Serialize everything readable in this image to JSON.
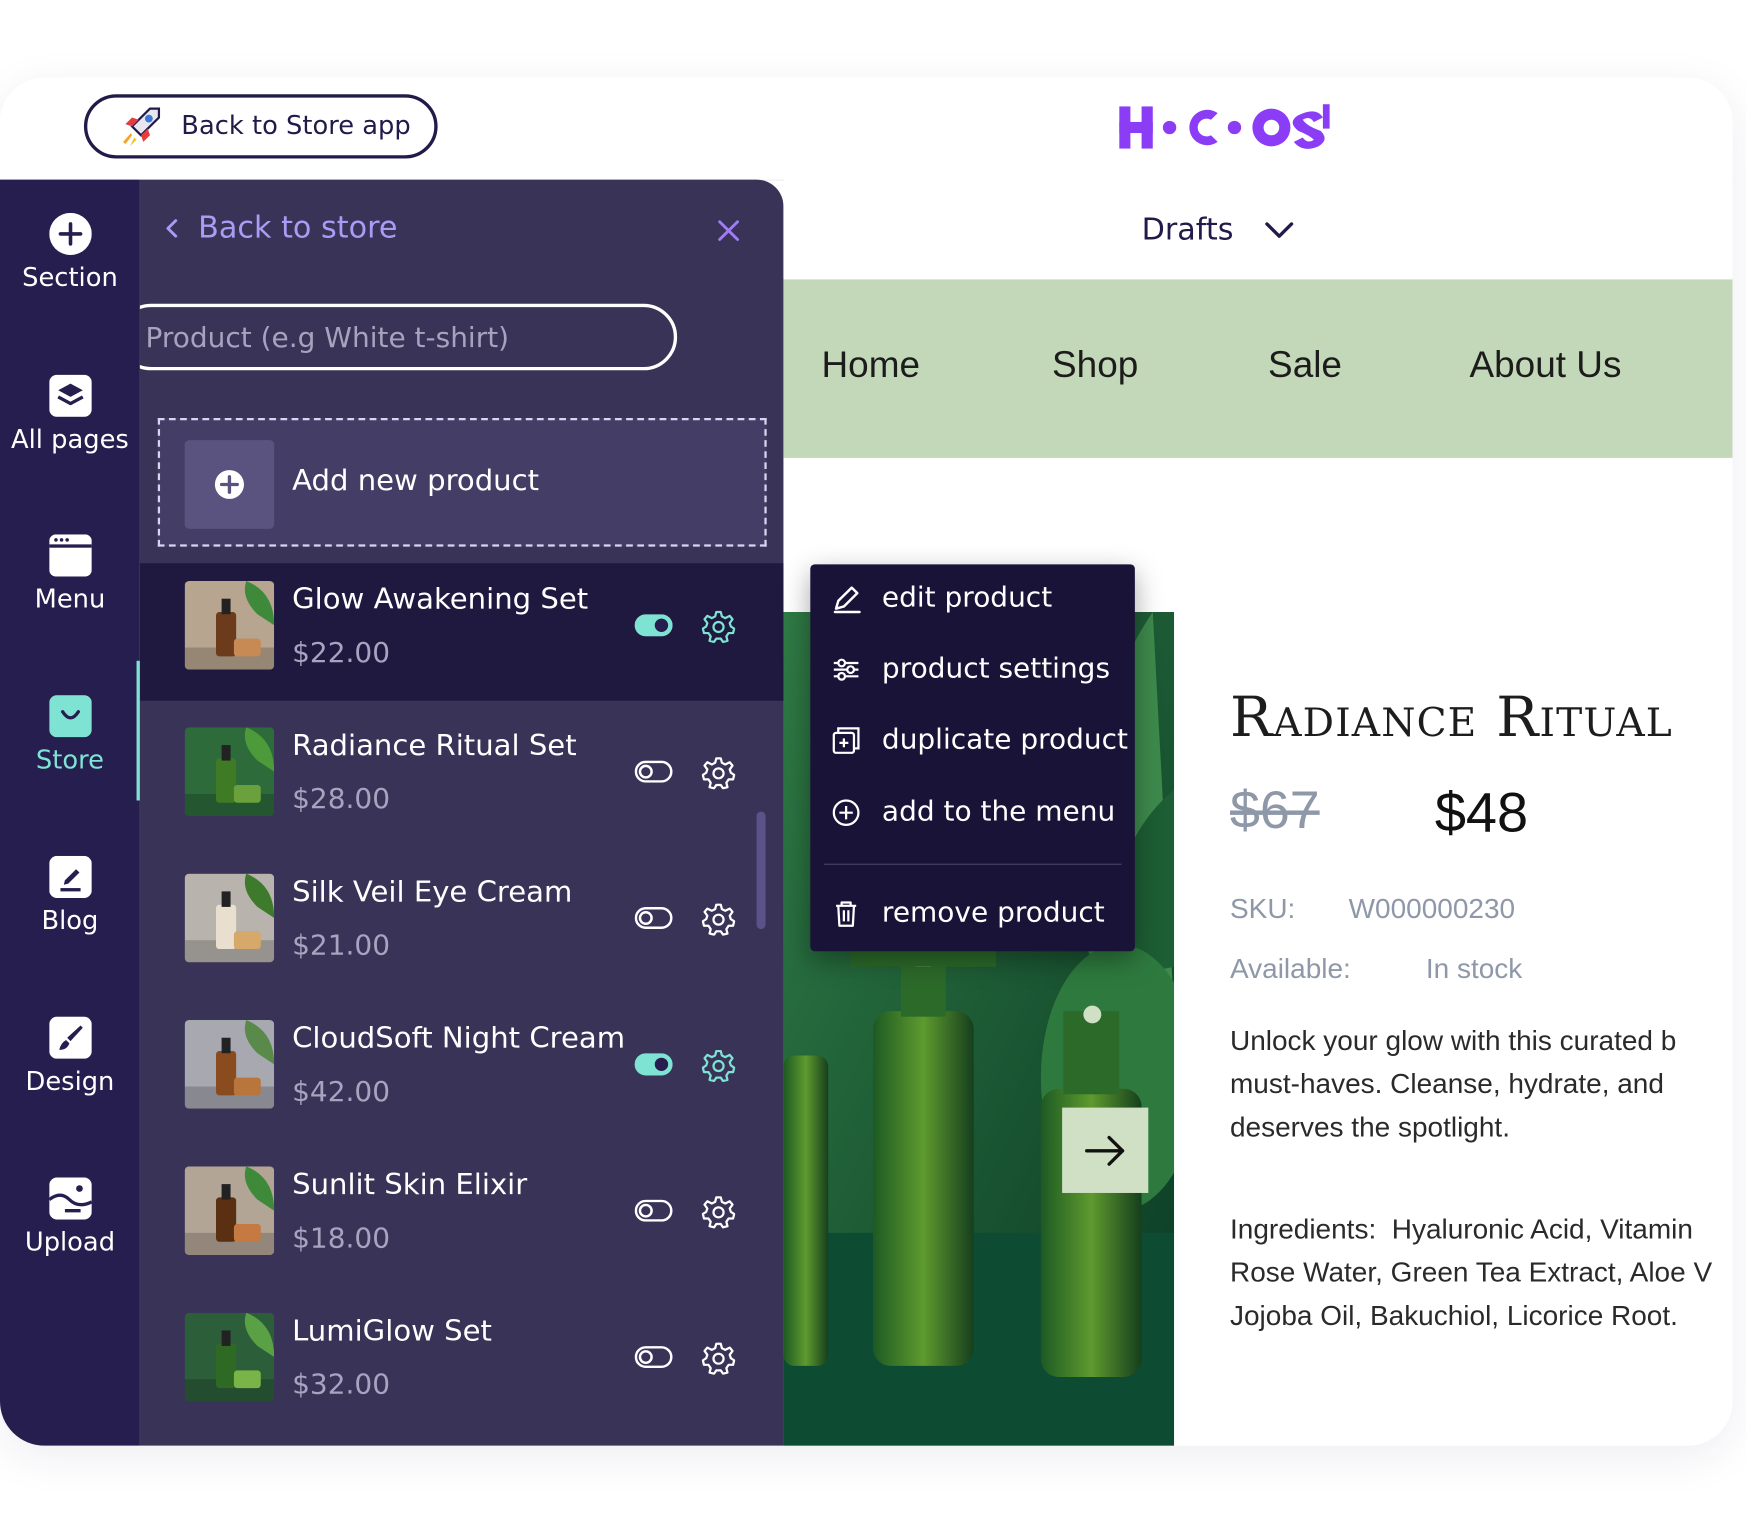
{
  "header": {
    "back_to_app_label": "Back to Store app",
    "logo_text": "H•C•O$"
  },
  "rail": {
    "items": [
      {
        "label": "Section",
        "icon": "plus-circle-icon"
      },
      {
        "label": "All pages",
        "icon": "layers-icon"
      },
      {
        "label": "Menu",
        "icon": "menu-window-icon"
      },
      {
        "label": "Store",
        "icon": "store-bag-icon",
        "active": true
      },
      {
        "label": "Blog",
        "icon": "edit-note-icon"
      },
      {
        "label": "Design",
        "icon": "brush-icon"
      },
      {
        "label": "Upload",
        "icon": "image-upload-icon"
      }
    ]
  },
  "panel": {
    "back_label": "Back to store",
    "search_placeholder": "Product (e.g White t-shirt)",
    "add_new_label": "Add new product",
    "products": [
      {
        "name": "Glow Awakening Set",
        "price": "$22.00",
        "enabled": true,
        "selected": true
      },
      {
        "name": "Radiance Ritual Set",
        "price": "$28.00",
        "enabled": false
      },
      {
        "name": "Silk Veil Eye Cream",
        "price": "$21.00",
        "enabled": false
      },
      {
        "name": "CloudSoft Night Cream",
        "price": "$42.00",
        "enabled": true
      },
      {
        "name": "Sunlit Skin Elixir",
        "price": "$18.00",
        "enabled": false
      },
      {
        "name": "LumiGlow Set",
        "price": "$32.00",
        "enabled": false
      }
    ]
  },
  "context_menu": {
    "items": [
      {
        "label": "edit product",
        "icon": "pencil-icon"
      },
      {
        "label": "product settings",
        "icon": "sliders-icon"
      },
      {
        "label": "duplicate product",
        "icon": "duplicate-icon"
      },
      {
        "label": "add to the menu",
        "icon": "plus-circle-icon"
      },
      {
        "label": "remove product",
        "icon": "trash-icon"
      }
    ]
  },
  "preview": {
    "drafts_label": "Drafts",
    "nav": [
      "Home",
      "Shop",
      "Sale",
      "About Us"
    ],
    "title": "Radiance Ritual",
    "old_price": "$67",
    "new_price": "$48",
    "sku_label": "SKU:",
    "sku_value": "W000000230",
    "available_label": "Available:",
    "available_value": "In stock",
    "description": "Unlock your glow with this curated b\nmust-haves. Cleanse, hydrate, and \ndeserves the spotlight.",
    "ingredients": "Ingredients:  Hyaluronic Acid, Vitamin\nRose Water, Green Tea Extract, Aloe V\nJojoba Oil, Bakuchiol, Licorice Root."
  },
  "colors": {
    "brand": "#8b3df5",
    "rail_bg": "#261e4e",
    "panel_bg": "#3a3358",
    "accent": "#7fe3d4",
    "nav_bg": "#c3d8b8"
  }
}
